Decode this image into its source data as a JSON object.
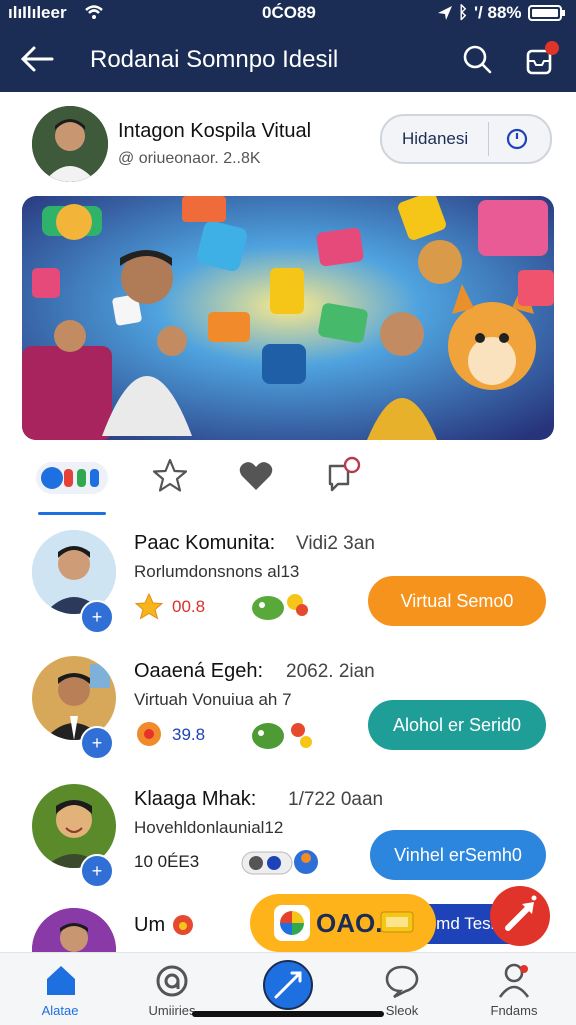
{
  "status": {
    "carrier": "ılıIlıleer",
    "time": "0ĆO89",
    "battery": "'/ 88%"
  },
  "appbar": {
    "title": "Rodanai Somnpo Idesil"
  },
  "profile": {
    "name": "Intagon Kospila Vitual",
    "handle": "@ oriueonaor. 2..8K",
    "pill_label": "Hidanesi"
  },
  "tabs": {
    "cta": "Vacmd Teshsle"
  },
  "rows": [
    {
      "name": "Paac Komunita:",
      "meta": "Vidi2 3an",
      "sub": "Rorlumdonsnons al13",
      "stat": "00.8",
      "button": "Virtual Semo0",
      "button_color": "#f6931d"
    },
    {
      "name": "Oaaená Egeh:",
      "meta": "2062. 2ian",
      "sub": "Virtuah Vonuiua ah 7",
      "stat": "39.8",
      "button": "Alohol er Serid0",
      "button_color": "#1f9e97"
    },
    {
      "name": "Klaaga Mhak:",
      "meta": "1/722 0aan",
      "sub": "Hovehldonlaunial12",
      "stat": "10 0ÉЕ3",
      "button": "Vinhel erSemh0",
      "button_color": "#2c86de"
    },
    {
      "name": "Um"
    }
  ],
  "promo": {
    "label": "OAO."
  },
  "bottom_nav": [
    {
      "label": "Alatae",
      "active": true
    },
    {
      "label": "Umiiries"
    },
    {
      "label": ""
    },
    {
      "label": "Sleok"
    },
    {
      "label": "Fndams"
    }
  ],
  "colors": {
    "navy": "#1c2d55",
    "blue": "#1e43b8",
    "orange": "#f6931d",
    "teal": "#1f9e97",
    "red": "#e0332a"
  }
}
